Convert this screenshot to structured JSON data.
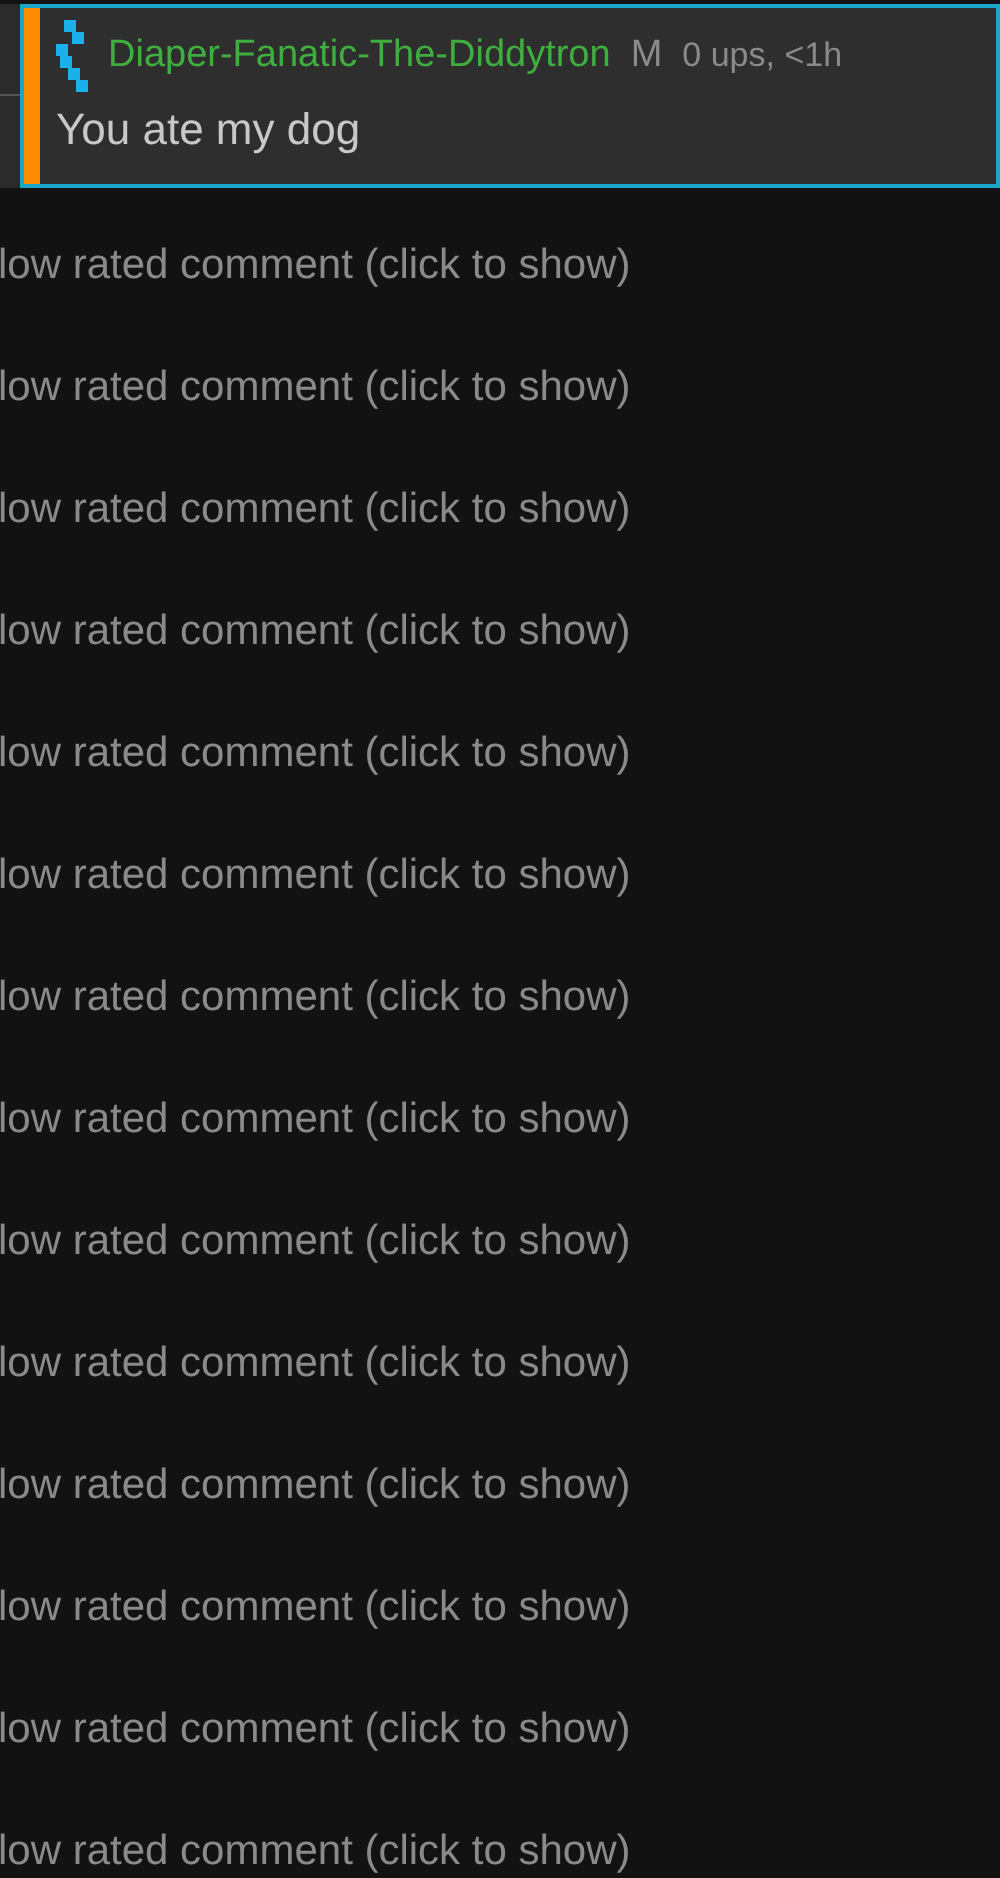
{
  "comment": {
    "username": "Diaper-Fanatic-The-Diddytron",
    "badge": "M",
    "meta": "0 ups, <1h",
    "text": "You ate my dog"
  },
  "collapsed_comments": [
    "low rated comment (click to show)",
    "low rated comment (click to show)",
    "low rated comment (click to show)",
    "low rated comment (click to show)",
    "low rated comment (click to show)",
    "low rated comment (click to show)",
    "low rated comment (click to show)",
    "low rated comment (click to show)",
    "low rated comment (click to show)",
    "low rated comment (click to show)",
    "low rated comment (click to show)",
    "low rated comment (click to show)",
    "low rated comment (click to show)",
    "low rated comment (click to show)"
  ]
}
